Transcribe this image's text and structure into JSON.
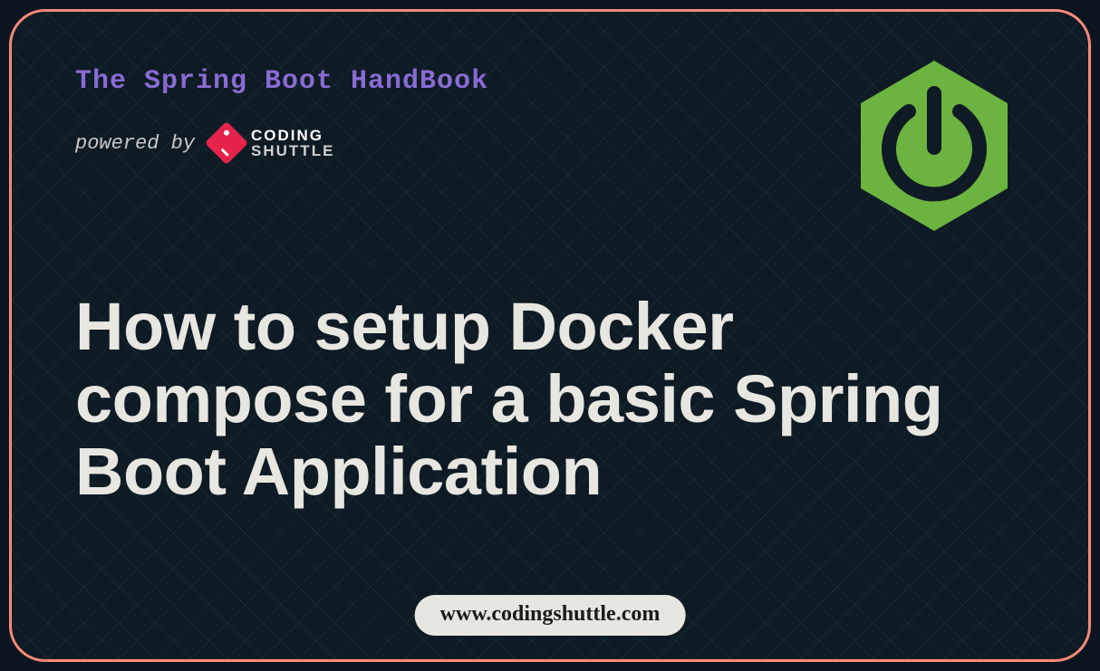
{
  "header": {
    "handbook_title": "The Spring Boot HandBook",
    "powered_by_label": "powered by",
    "brand": {
      "line1": "CODING",
      "line2": "SHUTTLE"
    }
  },
  "title": "How to setup Docker compose for a basic Spring Boot Application",
  "footer_url": "www.codingshuttle.com",
  "colors": {
    "border": "#ff8a7a",
    "accent_purple": "#8a6bd4",
    "spring_green": "#6db33f",
    "bg": "#0e1a24"
  }
}
